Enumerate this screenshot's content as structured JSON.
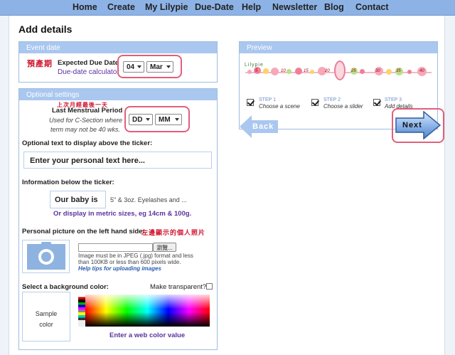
{
  "nav": [
    "Home",
    "Create",
    "My Lilypie",
    "Due-Date",
    "Help",
    "Newsletter",
    "Blog",
    "Contact"
  ],
  "page_title": "Add details",
  "event_date": {
    "header": "Event date",
    "chinese_label": "預產期",
    "label": "Expected Due Date",
    "calculator_link": "Due-date calculator",
    "day": "04",
    "month": "Mar"
  },
  "optional": {
    "header": "Optional settings",
    "chinese_last_period": "上次月經最後一天",
    "last_period_label": "Last Menstrual Period",
    "csection_note_1": "Used for C-Section where",
    "csection_note_2": "term may not be 40 wks.",
    "day": "DD",
    "month": "MM",
    "above_ticker_label": "Optional text to display above the ticker:",
    "above_ticker_placeholder": "Enter your personal text here...",
    "below_ticker_label": "Information below the ticker:",
    "below_ticker_value": "Our baby is",
    "below_ticker_suffix": "5\" & 3oz. Eyelashes and ...",
    "metric_link": "Or display in metric sizes, eg 14cm & 100g.",
    "picture_label": "Personal picture on the left hand side:",
    "picture_chinese": "左邊顯示的個人照片",
    "browse_button": "瀏覽...",
    "picture_note_1": "Image must be in JPEG (.jpg) format and less",
    "picture_note_2": "than 100KB or less than 600 pixels wide.",
    "picture_help": "Help tips for uploading images",
    "bg_color_label": "Select a background color:",
    "transparent_label": "Make transparent?",
    "transparent_checked": false,
    "sample_color_line1": "Sample",
    "sample_color_line2": "color",
    "web_color_link": "Enter a web color value"
  },
  "preview": {
    "header": "Preview",
    "ticker_brand": "Lilypie",
    "ticker_numbers": [
      "5",
      "10",
      "15",
      "20",
      "25",
      "30",
      "35",
      "40"
    ],
    "steps": [
      {
        "step": "STEP 1",
        "label": "Choose a scene"
      },
      {
        "step": "STEP 2",
        "label": "Choose a slider"
      },
      {
        "step": "STEP 3",
        "label": "Add details"
      }
    ],
    "back_button": "Back",
    "next_button": "Next"
  },
  "colors": {
    "accent": "#a9c7ef",
    "highlight": "#e0607a",
    "link": "#5a32a0"
  }
}
